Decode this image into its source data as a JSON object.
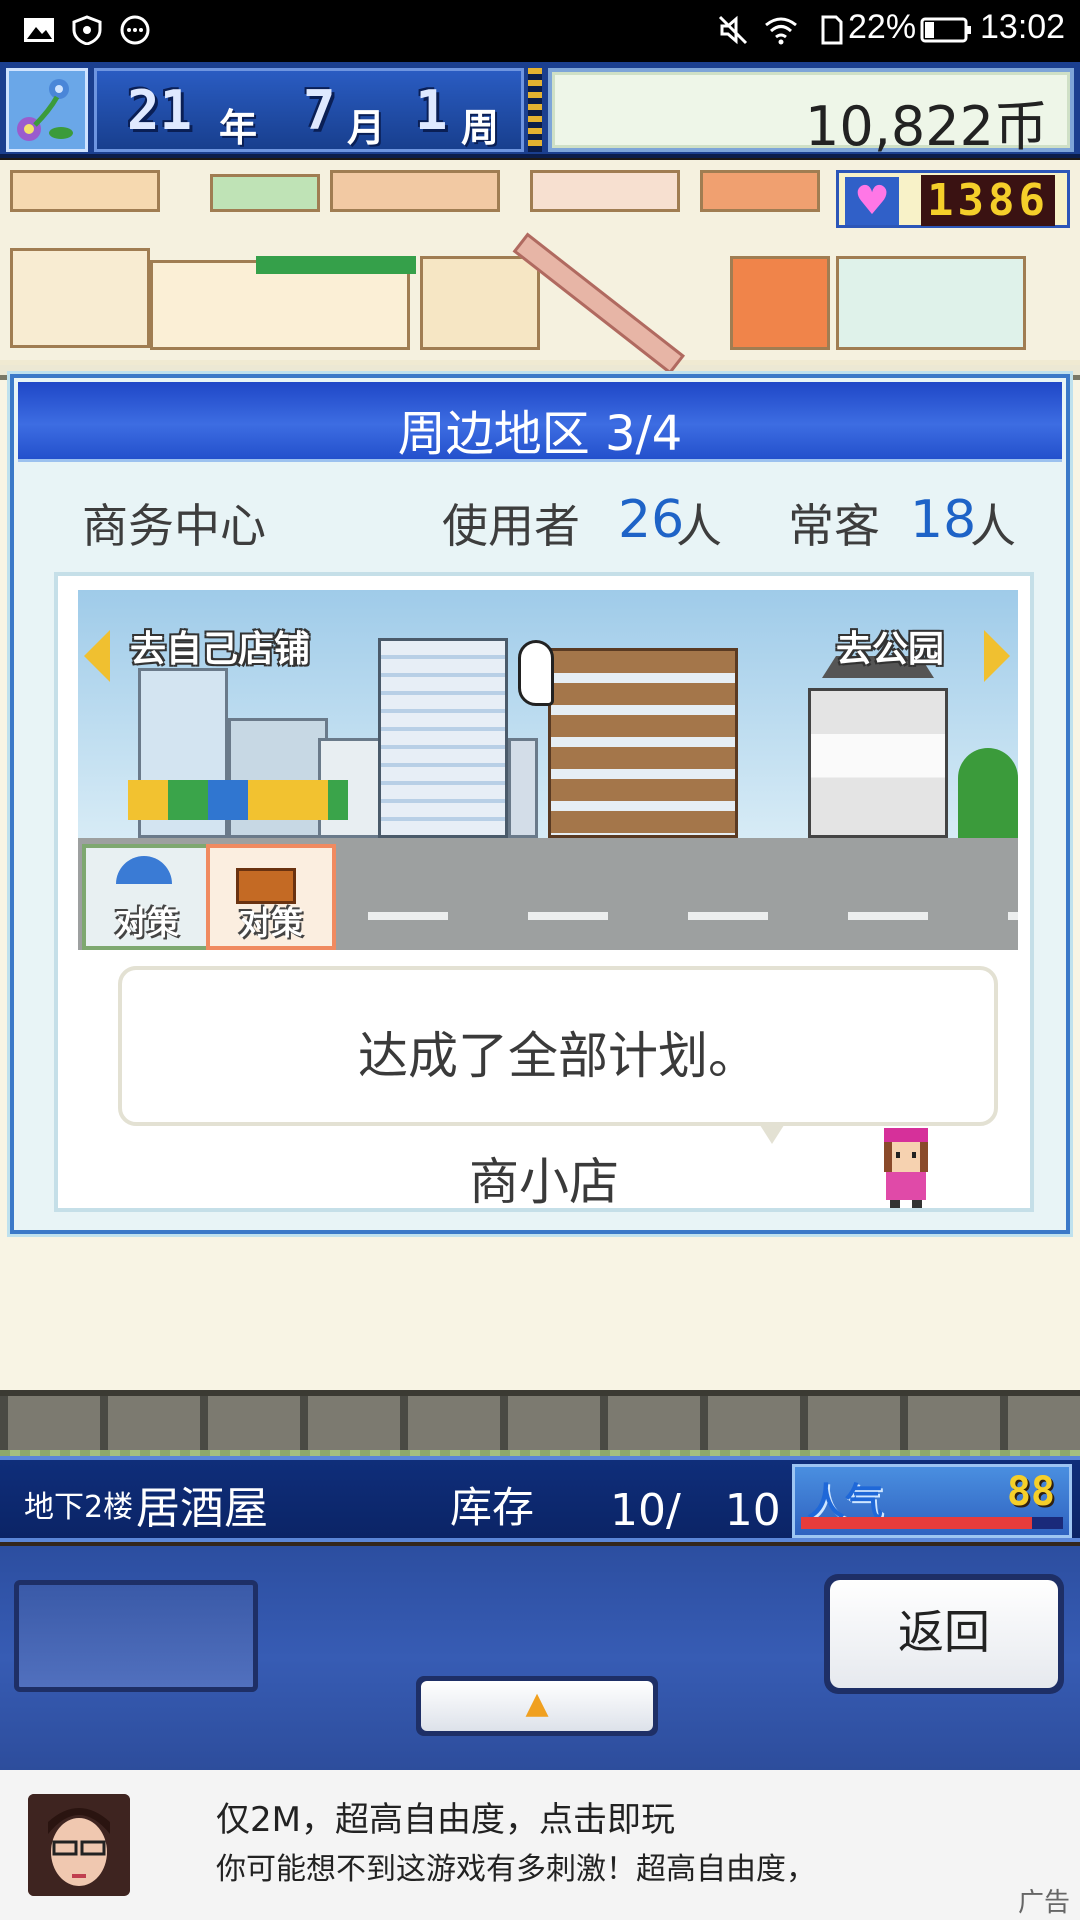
{
  "status_bar": {
    "battery_percent": "22%",
    "time": "13:02",
    "icons": [
      "image-icon",
      "shield-icon",
      "more-icon",
      "mute-icon",
      "wifi-icon",
      "sim-icon",
      "battery-icon"
    ]
  },
  "hud": {
    "year": "21",
    "year_unit": "年",
    "month": "7",
    "month_unit": "月",
    "week": "1",
    "week_unit": "周",
    "money": "10,822币",
    "popularity_points": "1386"
  },
  "dialog": {
    "title": "周边地区 3/4",
    "area_name": "商务中心",
    "users_label": "使用者",
    "users_count": "26",
    "users_unit": "人",
    "regulars_label": "常客",
    "regulars_count": "18",
    "regulars_unit": "人",
    "nav_left_label": "去自己店铺",
    "nav_right_label": "去公园",
    "plan_cards": [
      {
        "label": "对策"
      },
      {
        "label": "对策"
      }
    ],
    "message": "达成了全部计划。",
    "speaker": "商小店"
  },
  "info_bar": {
    "floor": "地下2楼",
    "shop_name": "居酒屋",
    "stock_label": "库存",
    "stock_value": "10/　10",
    "popularity_label": "人气",
    "popularity_value": "88",
    "popularity_fill": 0.88
  },
  "controls": {
    "return_label": "返回",
    "up_symbol": "▲"
  },
  "ad": {
    "title": "仅2M，超高自由度，点击即玩",
    "description": "你可能想不到这游戏有多刺激！超高自由度，",
    "tag": "广告"
  },
  "colors": {
    "header_blue": "#2350cc",
    "stat_blue": "#1e63c7",
    "popularity_gold": "#f5cf2a",
    "heart_pink": "#ff77e6"
  }
}
